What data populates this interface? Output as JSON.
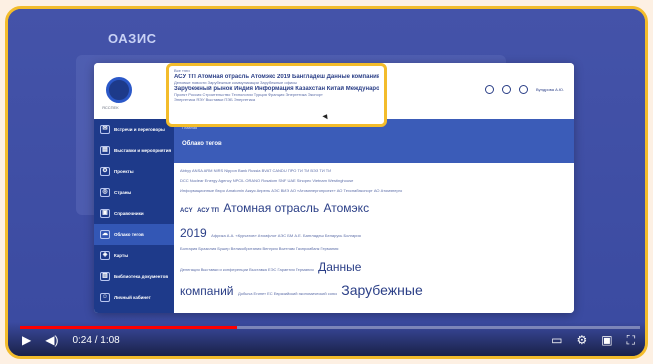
{
  "brand": "ОАЗИС",
  "logo_caption": "ЯССПЕК",
  "topbar": {
    "user": "Вундрова А.Ю."
  },
  "sidebar": {
    "items": [
      {
        "label": "Встречи и переговоры",
        "icon": "chat-icon"
      },
      {
        "label": "Выставки и мероприятия",
        "icon": "mail-icon"
      },
      {
        "label": "Проекты",
        "icon": "gear-icon"
      },
      {
        "label": "Страны",
        "icon": "globe-icon"
      },
      {
        "label": "Справочники",
        "icon": "book-icon"
      },
      {
        "label": "Облако тегов",
        "icon": "cloud-icon"
      },
      {
        "label": "Карты",
        "icon": "map-icon"
      },
      {
        "label": "Библиотека документов",
        "icon": "library-icon"
      },
      {
        "label": "Личный кабинет",
        "icon": "user-icon"
      }
    ]
  },
  "content": {
    "crumb": "Главная",
    "title": "Облако тегов"
  },
  "cloud": {
    "line1": "Abbyy ANSA ARM NIRS Nippon Bank Russia BVAT CANDU ПРО ТИ ТИ ВЭЗ ТИ ТИ",
    "line2": "DCC Nuclear Energy Agency NPCIL ORANO Rosatom SNF UAE Sinopec Vietnam Westinghouse",
    "line3": "Информационные бюро Amatomin Аккуя Апрель АЭС ВИЭ АО «Атомэнергопроект» АО Техснабэкспорт АО Атомэнерго",
    "line4a": "ACY",
    "line4b": "АСУ ТП",
    "line4c": "Атомная отрасль",
    "line4d": "Атомэкс",
    "line5a": "2019",
    "line5b": "Африка А.А. «Курчатов» Атомфлот АЭС БМ А.Е. Бангладеш Беларусь Болгария",
    "line6": "Болгария Бразилия Бушер Великобритания Венгрия Вьетнам Газпромбанк Германия",
    "line7a": "Делегация Выставки и конференции Выставка ЕЭС Гарантия Германия",
    "line7b": "Данные",
    "line8a": "компаний",
    "line8b": "Добыча Египет ЕС Евразийский экономический союз",
    "line8c": "Зарубежные"
  },
  "highlight": {
    "line1": "Все тэги",
    "line2": "АСУ ТП Атомная отрасль Атомэкс 2019 Бангладеш Данные компаний",
    "line3": "Деловые новости Зарубежные коммуникации Зарубежные офисы",
    "line4": "Зарубежный рынок Индия Информация Казахстан Китай Международное",
    "line5": "Проект Россия Строительство Технологии Турция Франция Энергетика Экспорт",
    "line6": "Энергетика ЯЭУ Выставки ПЭБ Энергетика"
  },
  "player": {
    "time": "0:24 / 1:08",
    "progress": 0.35
  }
}
